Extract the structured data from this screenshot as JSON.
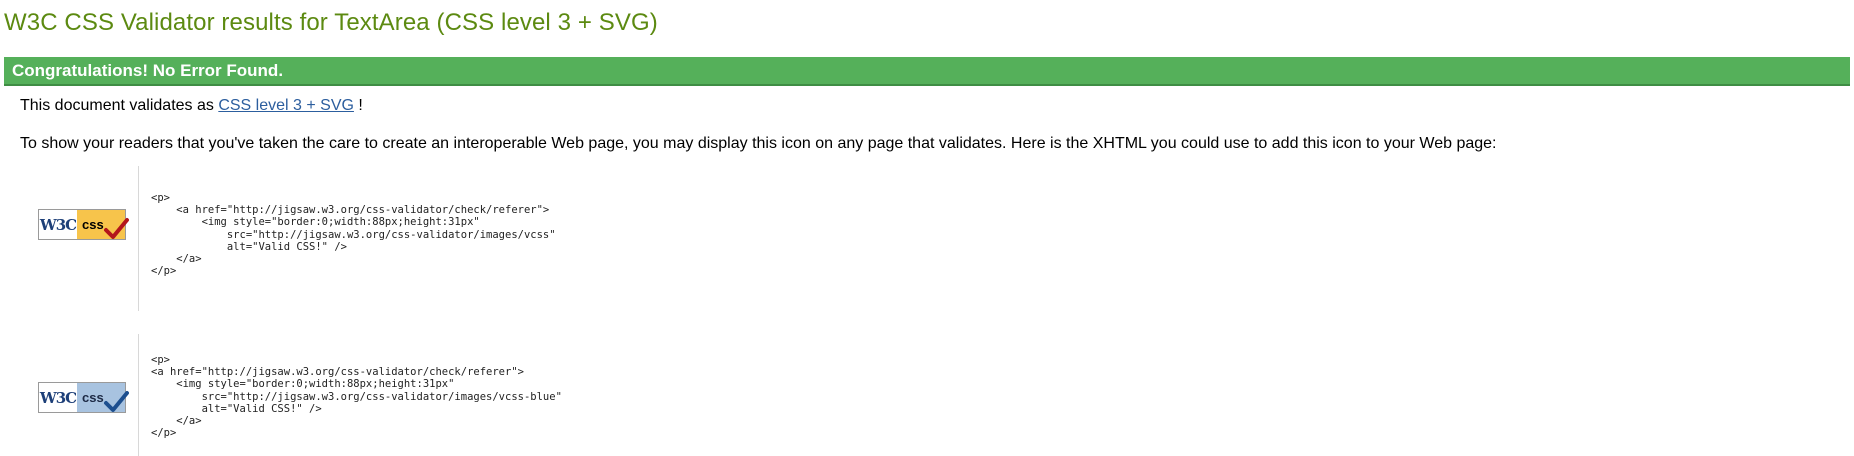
{
  "page": {
    "title": "W3C CSS Validator results for TextArea (CSS level 3 + SVG)"
  },
  "result": {
    "heading": "Congratulations! No Error Found.",
    "validates_prefix": "This document validates as ",
    "validates_link": "CSS level 3 + SVG",
    "validates_suffix": " !",
    "readers_text": "To show your readers that you've taken the care to create an interoperable Web page, you may display this icon on any page that validates. Here is the XHTML you could use to add this icon to your Web page:"
  },
  "badges": [
    {
      "left_text": "W3C",
      "right_text": "css",
      "variant": "gold",
      "check_color": "#b3151b",
      "icon": "w3c-css-valid-badge-gold",
      "code": "<p>\n    <a href=\"http://jigsaw.w3.org/css-validator/check/referer\">\n        <img style=\"border:0;width:88px;height:31px\"\n            src=\"http://jigsaw.w3.org/css-validator/images/vcss\"\n            alt=\"Valid CSS!\" />\n    </a>\n</p>"
    },
    {
      "left_text": "W3C",
      "right_text": "css",
      "variant": "blue",
      "check_color": "#1d4f8f",
      "icon": "w3c-css-valid-badge-blue",
      "code": "<p>\n<a href=\"http://jigsaw.w3.org/css-validator/check/referer\">\n    <img style=\"border:0;width:88px;height:31px\"\n        src=\"http://jigsaw.w3.org/css-validator/images/vcss-blue\"\n        alt=\"Valid CSS!\" />\n    </a>\n</p>"
    }
  ],
  "colors": {
    "title": "#5c8a11",
    "success_bar": "#55b05a",
    "link": "#2c5e9e"
  }
}
